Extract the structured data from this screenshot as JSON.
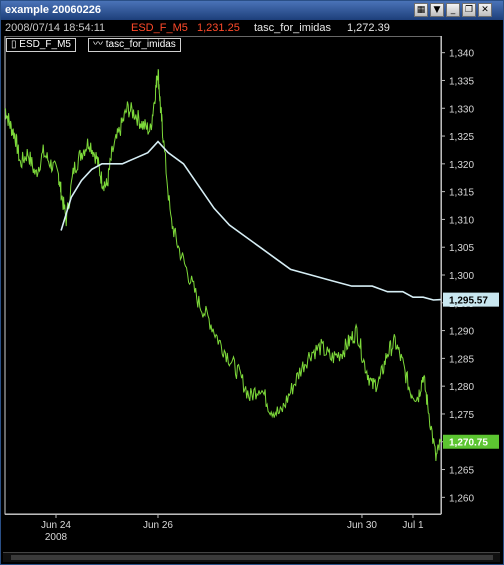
{
  "window": {
    "title": "example 20060226"
  },
  "infobar": {
    "timestamp": "2008/07/14 18:54:11",
    "instrument": "ESD_F_M5",
    "instrument_value": "1,231.25",
    "indicator": "tasc_for_imidas",
    "indicator_value": "1,272.39"
  },
  "legend": [
    {
      "icon": "bar-chart-icon",
      "label": "ESD_F_M5"
    },
    {
      "icon": "line-chart-icon",
      "label": "tasc_for_imidas"
    }
  ],
  "colors": {
    "price": "#7dd93a",
    "indicator": "#d6eef5",
    "instrument_text": "#ff4a2a",
    "price_tag_bg": "#5cc531",
    "indicator_tag_bg": "#c9e7f0",
    "axis": "#bcbcbc"
  },
  "chart_data": {
    "type": "line",
    "y_axis": {
      "ticks": [
        1260,
        1265,
        1270,
        1275,
        1280,
        1285,
        1290,
        1295,
        1300,
        1305,
        1310,
        1315,
        1320,
        1325,
        1330,
        1335,
        1340
      ],
      "tick_labels": [
        "1,260",
        "1,265",
        "1,270",
        "1,275",
        "1,280",
        "1,285",
        "1,290",
        "1,295",
        "1,300",
        "1,305",
        "1,310",
        "1,315",
        "1,320",
        "1,325",
        "1,330",
        "1,335",
        "1,340"
      ],
      "ylim": [
        1257,
        1343
      ]
    },
    "x_axis": {
      "ticks": [
        {
          "label": "Jun 24",
          "sublabel": "2008",
          "day": 24
        },
        {
          "label": "Jun 26",
          "sublabel": "",
          "day": 26
        },
        {
          "label": "Jun 30",
          "sublabel": "",
          "day": 30
        },
        {
          "label": "Jul 1",
          "sublabel": "",
          "day": 31
        }
      ],
      "xlim": [
        23.0,
        31.55
      ]
    },
    "series": [
      {
        "name": "ESD_F_M5",
        "x": [
          23.0,
          23.1,
          23.2,
          23.3,
          23.45,
          23.6,
          23.75,
          23.9,
          24.05,
          24.1,
          24.2,
          24.35,
          24.5,
          24.65,
          24.8,
          24.9,
          25.0,
          25.1,
          25.25,
          25.4,
          25.55,
          25.7,
          25.85,
          25.95,
          26.0,
          26.05,
          26.1,
          26.25,
          26.4,
          26.6,
          26.8,
          27.0,
          27.2,
          27.4,
          27.6,
          27.8,
          28.0,
          28.2,
          28.4,
          28.6,
          28.8,
          29.0,
          29.2,
          29.4,
          29.6,
          29.75,
          29.9,
          30.05,
          30.2,
          30.35,
          30.5,
          30.65,
          30.8,
          30.95,
          31.1,
          31.2,
          31.3,
          31.45,
          31.55
        ],
        "y": [
          1330,
          1327,
          1325,
          1320,
          1322,
          1318,
          1322,
          1320,
          1318,
          1315,
          1310,
          1319,
          1322,
          1324,
          1321,
          1317,
          1316,
          1322,
          1326,
          1330,
          1329,
          1327,
          1326,
          1333,
          1337,
          1330,
          1325,
          1310,
          1305,
          1300,
          1295,
          1292,
          1288,
          1285,
          1282,
          1278,
          1280,
          1276,
          1275,
          1279,
          1283,
          1286,
          1287,
          1285,
          1286,
          1288,
          1290,
          1284,
          1280,
          1281,
          1286,
          1288,
          1284,
          1279,
          1278,
          1282,
          1276,
          1267,
          1270
        ]
      },
      {
        "name": "tasc_for_imidas",
        "x": [
          24.1,
          24.3,
          24.5,
          24.7,
          24.9,
          25.1,
          25.3,
          25.55,
          25.8,
          26.0,
          26.2,
          26.5,
          26.8,
          27.1,
          27.4,
          27.7,
          28.0,
          28.3,
          28.6,
          29.0,
          29.4,
          29.8,
          30.2,
          30.5,
          30.8,
          31.0,
          31.2,
          31.4,
          31.55
        ],
        "y": [
          1308,
          1314,
          1317,
          1319,
          1320,
          1320,
          1320,
          1321,
          1322,
          1324,
          1322,
          1320,
          1316,
          1312,
          1309,
          1307,
          1305,
          1303,
          1301,
          1300,
          1299,
          1298,
          1298,
          1297,
          1297,
          1296,
          1296,
          1295.5,
          1295.57
        ]
      }
    ],
    "last_value_tags": [
      {
        "series": "tasc_for_imidas",
        "label": "1,295.57"
      },
      {
        "series": "ESD_F_M5",
        "label": "1,270.75"
      }
    ],
    "grid": false
  }
}
